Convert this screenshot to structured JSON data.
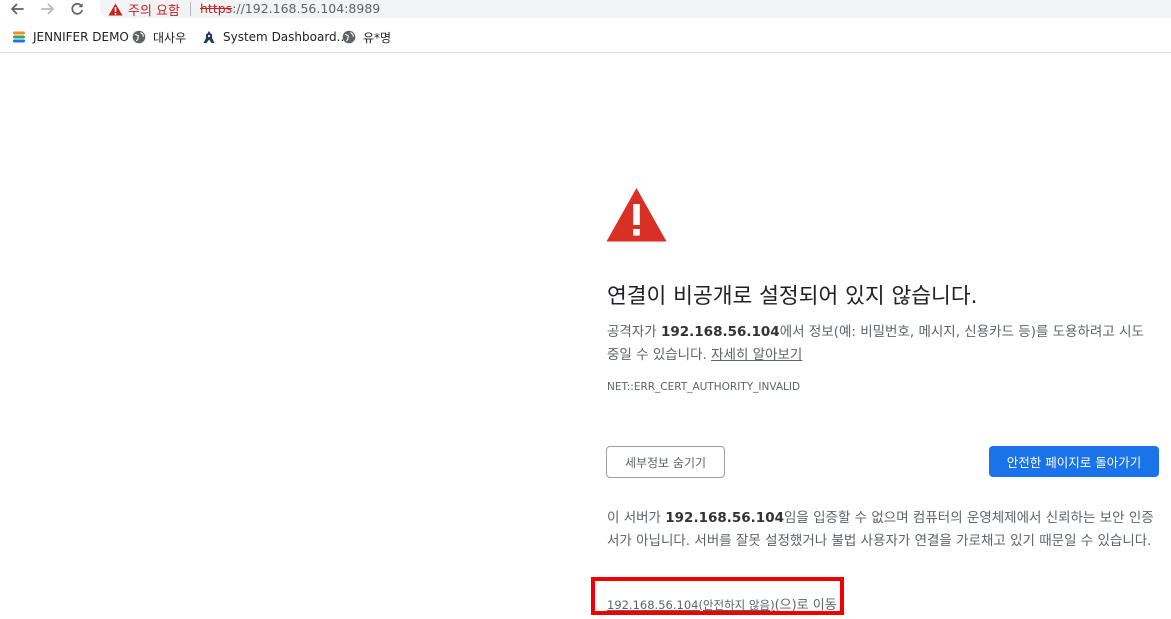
{
  "toolbar": {
    "back_icon": "arrow-left-icon",
    "forward_icon": "arrow-right-icon",
    "reload_icon": "reload-icon",
    "security_chip": {
      "icon": "warning-triangle-icon",
      "label": "주의 요함"
    },
    "url": {
      "scheme": "https",
      "rest": "://192.168.56.104:8989"
    }
  },
  "bookmarks": [
    {
      "label": "JENNIFER DEMO",
      "icon": "jennifer-logo-icon"
    },
    {
      "label": "대사우",
      "icon": "globe-icon"
    },
    {
      "label": "System Dashboard...",
      "icon": "system-dashboard-icon"
    },
    {
      "label": "유*명",
      "icon": "globe-icon"
    }
  ],
  "interstitial": {
    "warning_icon": "warning-triangle-icon",
    "heading": "연결이 비공개로 설정되어 있지 않습니다.",
    "explanation": {
      "prefix": "공격자가 ",
      "host": "192.168.56.104",
      "suffix": "에서 정보(예: 비밀번호, 메시지, 신용카드 등)를 도용하려고 시도 중일 수 있습니다. ",
      "learn_more": "자세히 알아보기"
    },
    "error_code": "NET::ERR_CERT_AUTHORITY_INVALID",
    "details_button": "세부정보 숨기기",
    "back_button": "안전한 페이지로 돌아가기",
    "details": {
      "prefix": "이 서버가 ",
      "host": "192.168.56.104",
      "suffix": "임을 입증할 수 없으며 컴퓨터의 운영체제에서 신뢰하는 보안 인증서가 아닙니다. 서버를 잘못 설정했거나 불법 사용자가 연결을 가로채고 있기 때문일 수 있습니다."
    },
    "proceed_link": {
      "link": "192.168.56.104(안전하지 않음)",
      "tail": "(으)로 이동"
    }
  },
  "colors": {
    "danger": "#d93025",
    "primary": "#1a73e8",
    "highlight": "#f20000"
  }
}
